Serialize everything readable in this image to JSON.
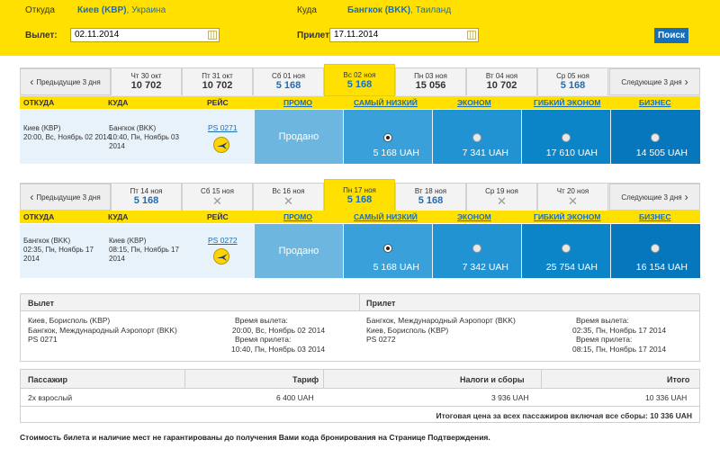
{
  "search": {
    "from_label": "Откуда",
    "from_city": "Киев (KBP)",
    "from_country": ", Украина",
    "to_label": "Куда",
    "to_city": "Бангкок (BKK)",
    "to_country": ", Таиланд",
    "depart_label": "Вылет:",
    "depart_value": "02.11.2014",
    "arrive_label": "Прилет:",
    "arrive_value": "17.11.2014",
    "search_button": "Поиск"
  },
  "outbound": {
    "prev_label": "Предыдущие 3 дня",
    "next_label": "Следующие 3 дня",
    "days": [
      {
        "date": "Чт 30 окт",
        "price": "10 702",
        "style": "dark"
      },
      {
        "date": "Пт 31 окт",
        "price": "10 702",
        "style": "dark"
      },
      {
        "date": "Сб 01 ноя",
        "price": "5 168",
        "style": "blue"
      },
      {
        "date": "Вс 02 ноя",
        "price": "5 168",
        "style": "selected"
      },
      {
        "date": "Пн 03 ноя",
        "price": "15 056",
        "style": "dark"
      },
      {
        "date": "Вт 04 ноя",
        "price": "10 702",
        "style": "dark"
      },
      {
        "date": "Ср 05 ноя",
        "price": "5 168",
        "style": "blue"
      }
    ],
    "headers": {
      "from": "ОТКУДА",
      "to": "КУДА",
      "flight": "РЕЙС",
      "promo": "ПРОМО",
      "lowest": "САМЫЙ НИЗКИЙ",
      "economy": "ЭКОНОМ",
      "flex": "ГИБКИЙ ЭКОНОМ",
      "business": "БИЗНЕС"
    },
    "flight": {
      "from_city": "Киев (KBP)",
      "from_time": "20:00, Вс, Ноябрь 02 2014",
      "to_city": "Бангкок (BKK)",
      "to_time_1": "10:40, Пн, Ноябрь 03",
      "to_time_2": "2014",
      "code": "PS 0271",
      "promo": "Продано",
      "lowest": "5 168 UAH",
      "economy": "7 341 UAH",
      "flex": "17 610 UAH",
      "business": "14 505 UAH"
    }
  },
  "inbound": {
    "prev_label": "Предыдущие 3 дня",
    "next_label": "Следующие 3 дня",
    "days": [
      {
        "date": "Пт 14 ноя",
        "price": "5 168",
        "style": "blue"
      },
      {
        "date": "Сб 15 ноя",
        "price": "✕",
        "style": "x"
      },
      {
        "date": "Вс 16 ноя",
        "price": "✕",
        "style": "x"
      },
      {
        "date": "Пн 17 ноя",
        "price": "5 168",
        "style": "selected"
      },
      {
        "date": "Вт 18 ноя",
        "price": "5 168",
        "style": "blue"
      },
      {
        "date": "Ср 19 ноя",
        "price": "✕",
        "style": "x"
      },
      {
        "date": "Чт 20 ноя",
        "price": "✕",
        "style": "x"
      }
    ],
    "headers": {
      "from": "ОТКУДА",
      "to": "КУДА",
      "flight": "РЕЙС",
      "promo": "ПРОМО",
      "lowest": "САМЫЙ НИЗКИЙ",
      "economy": "ЭКОНОМ",
      "flex": "ГИБКИЙ ЭКОНОМ",
      "business": "БИЗНЕС"
    },
    "flight": {
      "from_city": "Бангкок (BKK)",
      "from_time_1": "02:35, Пн, Ноябрь 17",
      "from_time_2": "2014",
      "to_city": "Киев (KBP)",
      "to_time_1": "08:15, Пн, Ноябрь 17",
      "to_time_2": "2014",
      "code": "PS 0272",
      "promo": "Продано",
      "lowest": "5 168 UAH",
      "economy": "7 342 UAH",
      "flex": "25 754 UAH",
      "business": "16 154 UAH"
    }
  },
  "summary": {
    "depart_header": "Вылет",
    "arrive_header": "Прилет",
    "depart": {
      "line1": "Киев, Борисполь (KBP)",
      "line2": "Бангкок, Международный Аэропорт (BKK)",
      "line3": "PS 0271",
      "dep_label": "Время вылета:",
      "dep_value": "20:00, Вс, Ноябрь 02 2014",
      "arr_label": "Время прилета:",
      "arr_value": "10:40, Пн, Ноябрь 03 2014"
    },
    "arrive": {
      "line1": "Бангкок, Международный Аэропорт (BKK)",
      "line2": "Киев, Борисполь (KBP)",
      "line3": "PS 0272",
      "dep_label": "Время вылета:",
      "dep_value": "02:35, Пн, Ноябрь 17 2014",
      "arr_label": "Время прилета:",
      "arr_value": "08:15, Пн, Ноябрь 17 2014"
    }
  },
  "fare": {
    "col_passenger": "Пассажир",
    "col_tariff": "Тариф",
    "col_taxes": "Налоги и сборы",
    "col_total": "Итого",
    "passenger": "2x взрослый",
    "tariff": "6 400 UAH",
    "taxes": "3 936 UAH",
    "total": "10 336 UAH",
    "grand_total": "Итоговая цена за всех пассажиров включая все сборы: 10 336 UAH"
  },
  "footnote": "Стоимость билета и наличие мест не гарантированы до получения Вами кода бронирования на Странице Подтверждения.",
  "colors": {
    "yellow": "#ffe000",
    "blue": "#1a6eb8",
    "promo": "#6cb6e0",
    "lowest": "#3aa0da",
    "economy": "#2193d3",
    "flex": "#0b84c8",
    "business": "#0677bd"
  }
}
